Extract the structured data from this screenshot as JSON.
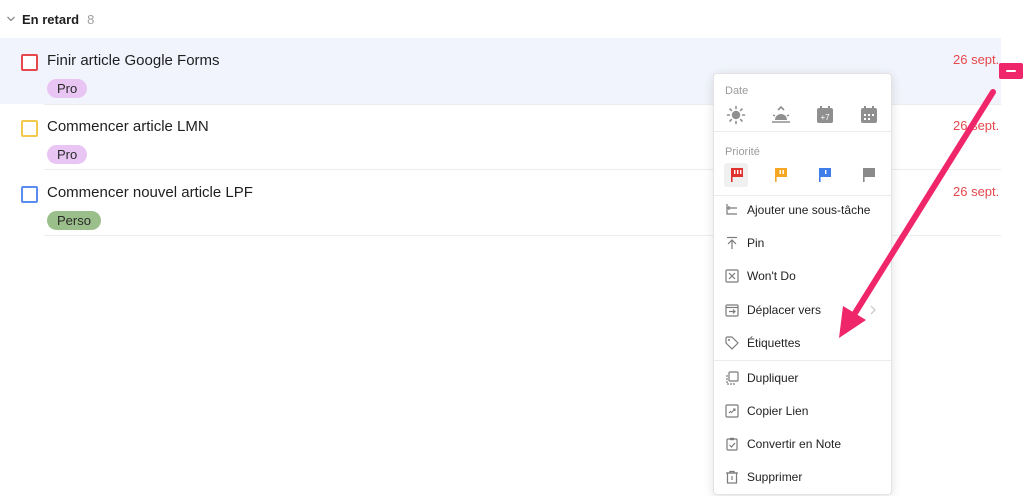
{
  "section": {
    "title": "En retard",
    "count": "8"
  },
  "tasks": [
    {
      "title": "Finir article Google Forms",
      "tag": "Pro",
      "due": "26 sept.",
      "checkbox_color": "#e5484d",
      "tag_color": "#e8c5f3",
      "selected": true
    },
    {
      "title": "Commencer article LMN",
      "tag": "Pro",
      "due": "26 sept.",
      "checkbox_color": "#f2c94c",
      "tag_color": "#e8c5f3",
      "selected": false
    },
    {
      "title": "Commencer nouvel article LPF",
      "tag": "Perso",
      "due": "26 sept.",
      "checkbox_color": "#5b8def",
      "tag_color": "#9bbf8a",
      "selected": false
    }
  ],
  "due_color": "#e5484d",
  "accent": "#f0266a",
  "menu": {
    "date_label": "Date",
    "date_icons": [
      "sun-icon",
      "sunrise-icon",
      "calendar-plus-7-icon",
      "calendar-icon"
    ],
    "date_plus_text": "+7",
    "priority_label": "Priorité",
    "priority_icons": [
      {
        "name": "flag-high-icon",
        "color": "#e0312f",
        "mark": "!!!"
      },
      {
        "name": "flag-medium-icon",
        "color": "#f5a623",
        "mark": "!!"
      },
      {
        "name": "flag-low-icon",
        "color": "#3f7ee8",
        "mark": "!"
      },
      {
        "name": "flag-none-icon",
        "color": "#8a8a8a",
        "mark": ""
      }
    ],
    "items": [
      {
        "label": "Ajouter une sous-tâche",
        "icon": "subtask-icon"
      },
      {
        "label": "Pin",
        "icon": "pin-icon"
      },
      {
        "label": "Won't Do",
        "icon": "wont-do-icon"
      },
      {
        "label": "Déplacer vers",
        "icon": "move-icon",
        "submenu": true
      },
      {
        "label": "Étiquettes",
        "icon": "tag-icon"
      },
      {
        "label": "Dupliquer",
        "icon": "duplicate-icon"
      },
      {
        "label": "Copier Lien",
        "icon": "link-icon"
      },
      {
        "label": "Convertir en Note",
        "icon": "note-icon"
      },
      {
        "label": "Supprimer",
        "icon": "trash-icon"
      }
    ]
  }
}
